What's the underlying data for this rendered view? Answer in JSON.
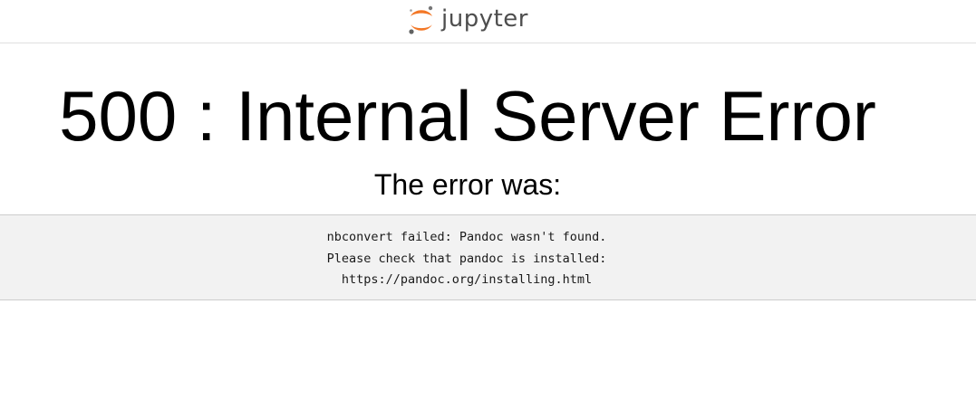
{
  "header": {
    "brand": "jupyter",
    "logo_colors": {
      "orange": "#f37726",
      "gray": "#767677",
      "dark_dot": "#616262"
    }
  },
  "error": {
    "title": "500 : Internal Server Error",
    "subtitle": "The error was:",
    "message_lines": [
      "nbconvert failed: Pandoc wasn't found.",
      "Please check that pandoc is installed:",
      "https://pandoc.org/installing.html"
    ]
  }
}
